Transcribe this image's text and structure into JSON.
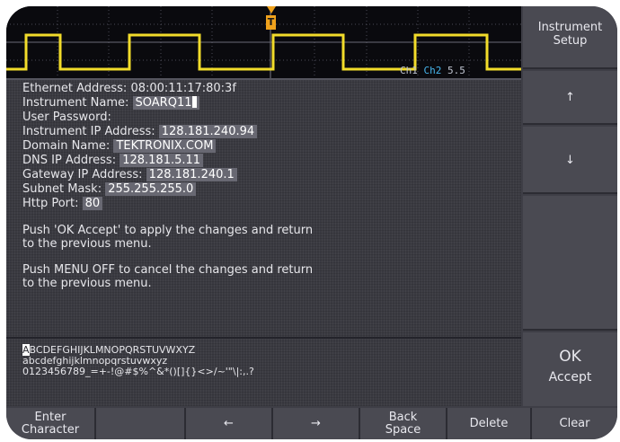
{
  "scope": {
    "trigger_marker": "T",
    "channel_labels": [
      "Ch1",
      "Ch2",
      "5.5"
    ]
  },
  "info_lines": {
    "ethernet_label": "Ethernet Address:",
    "ethernet_value": "08:00:11:17:80:3f",
    "name_label": "Instrument Name:",
    "name_value": "SOARQ11",
    "password_label": "User Password:",
    "ip_label": "Instrument IP Address:",
    "ip_value": "128.181.240.94",
    "domain_label": "Domain Name:",
    "domain_value": "TEKTRONIX.COM",
    "dns_label": "DNS IP Address:",
    "dns_value": "128.181.5.11",
    "gateway_label": "Gateway IP Address:",
    "gateway_value": "128.181.240.1",
    "subnet_label": "Subnet Mask:",
    "subnet_value": "255.255.255.0",
    "http_label": "Http Port:",
    "http_value": "80"
  },
  "messages": {
    "ok_line1": "Push 'OK Accept' to apply the changes and return",
    "ok_line2": "to the previous menu.",
    "cancel_line1": "Push MENU OFF to cancel the changes and return",
    "cancel_line2": "to the previous menu."
  },
  "charset": {
    "upper_first": "A",
    "upper_rest": "BCDEFGHIJKLMNOPQRSTUVWXYZ",
    "lower": "abcdefghijklmnopqrstuvwxyz",
    "symbols": "0123456789_=+-!@#$%^&*()[]{}<>/~'\"\\|:,.?"
  },
  "side_menu": {
    "setup_line1": "Instrument",
    "setup_line2": "Setup",
    "up": "↑",
    "down": "↓",
    "ok": "OK",
    "accept": "Accept"
  },
  "bottom_menu": {
    "enter_line1": "Enter",
    "enter_line2": "Character",
    "left": "←",
    "right": "→",
    "back_line1": "Back",
    "back_line2": "Space",
    "delete": "Delete",
    "clear": "Clear"
  },
  "colors": {
    "waveform": "#f2dc2a",
    "trigger": "#f0a21c",
    "channel2": "#47b6ee"
  }
}
